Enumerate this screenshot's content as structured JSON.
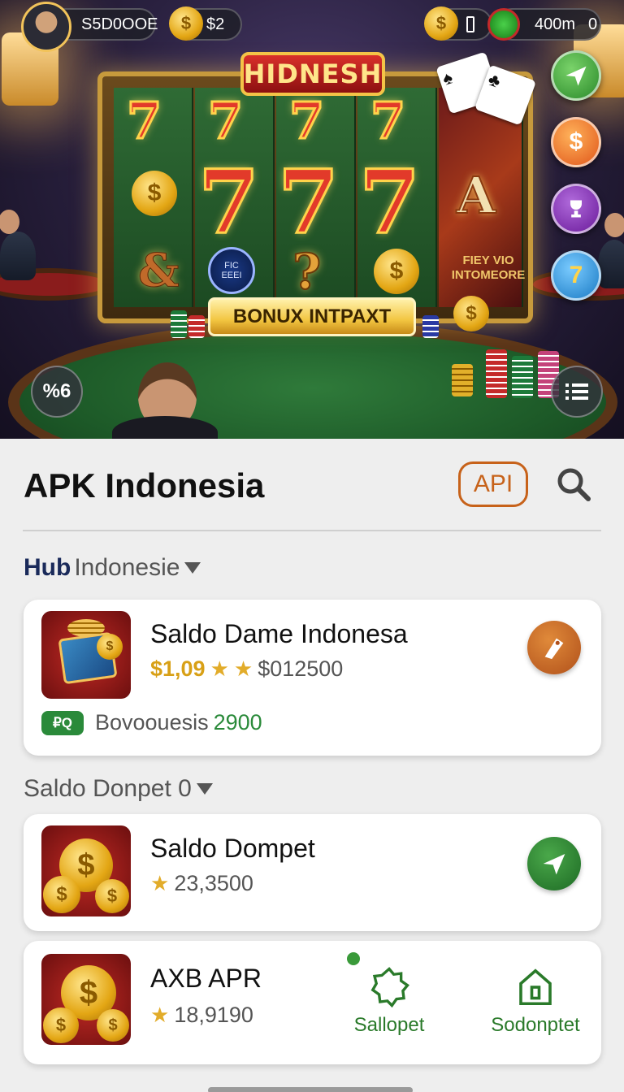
{
  "hud": {
    "balance": "S5D0OOE",
    "coins": "$2",
    "right_value": "400m",
    "right_count": "0"
  },
  "hero": {
    "game_title": "HIDNESH",
    "bonus_button": "BONUX INTPAXT",
    "feature_text": "FIEY VIO INTOMEORE",
    "rune_line1": "FIC",
    "rune_line2": "EEEI",
    "letter_symbol": "A",
    "percent_badge": "%6"
  },
  "header": {
    "title": "APK Indonesia",
    "api_label": "API"
  },
  "section1": {
    "bold": "Hub",
    "label": "Indonesie"
  },
  "card1": {
    "title": "Saldo Dame Indonesa",
    "price": "$1,09",
    "price_secondary": "$012500",
    "tag": "₽Q",
    "footer_label": "Bovoouesis",
    "footer_value": "2900"
  },
  "section2": {
    "label": "Saldo Donpet 0"
  },
  "card2": {
    "title": "Saldo Dompet",
    "rating": "23,3500"
  },
  "card3": {
    "title": "AXB APR",
    "rating": "18,9190",
    "nav1": "Sallopet",
    "nav2": "Sodonptet"
  },
  "colors": {
    "accent_orange": "#c7621a",
    "green": "#2a8a3a",
    "gold": "#d8a016"
  }
}
